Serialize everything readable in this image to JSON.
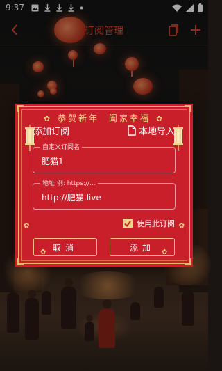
{
  "status_bar": {
    "time": "9:37",
    "left_icons": [
      "image-icon",
      "download-icon",
      "download-icon",
      "download-icon",
      "dot-icon"
    ],
    "right_icons": [
      "wifi-icon",
      "signal-icon",
      "battery-icon"
    ]
  },
  "app_bar": {
    "title": "订阅管理",
    "back_icon": "chevron-left-icon",
    "actions": [
      "clipboard-icon",
      "plus-icon"
    ]
  },
  "dialog": {
    "banner_left": "恭贺新年",
    "banner_right": "阖家幸福",
    "title": "添加订阅",
    "import_label": "本地导入",
    "name_field": {
      "label": "自定义订阅名",
      "value": "肥猫1"
    },
    "url_field": {
      "label": "地址 例: https://...",
      "value": "http://肥猫.live"
    },
    "use_checkbox": {
      "label": "使用此订阅",
      "checked": true
    },
    "cancel_label": "取消",
    "add_label": "添加"
  },
  "colors": {
    "dialog_bg": "#c81f2b",
    "gold": "#f3d28b",
    "accent_red": "#d6472e"
  }
}
